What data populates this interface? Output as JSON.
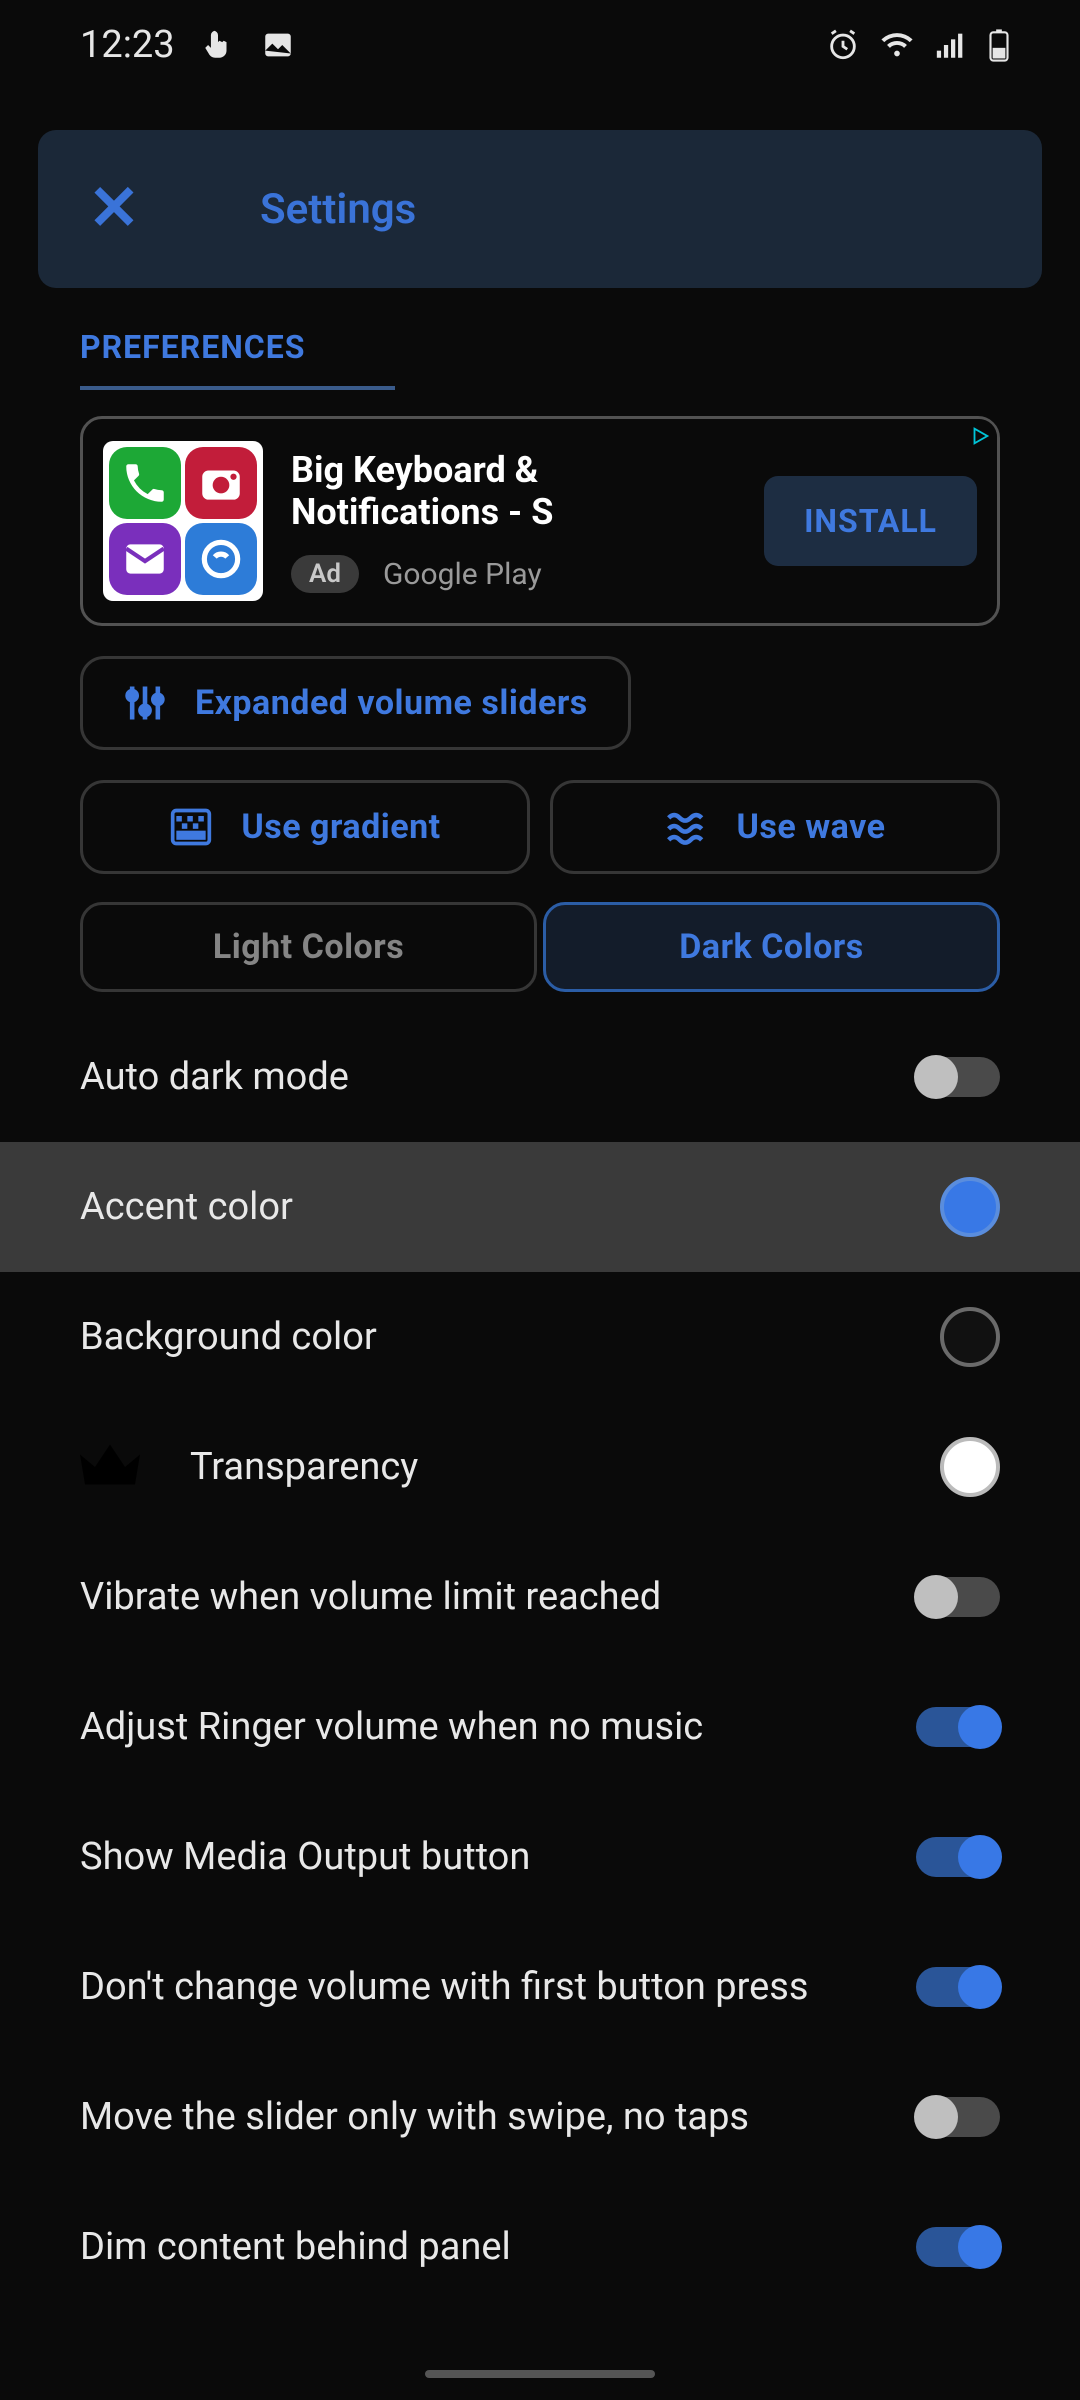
{
  "status": {
    "time": "12:23"
  },
  "header": {
    "title": "Settings"
  },
  "tabs": {
    "preferences": "PREFERENCES"
  },
  "ad": {
    "title": "Big Keyboard & Notifications - S",
    "badge": "Ad",
    "source": "Google Play",
    "cta": "INSTALL"
  },
  "buttons": {
    "expanded_sliders": "Expanded volume sliders",
    "use_gradient": "Use gradient",
    "use_wave": "Use wave"
  },
  "segments": {
    "light": "Light Colors",
    "dark": "Dark Colors"
  },
  "prefs": {
    "auto_dark": "Auto dark mode",
    "accent": "Accent color",
    "background": "Background color",
    "transparency": "Transparency",
    "vibrate_limit": "Vibrate when volume limit reached",
    "adjust_ringer": "Adjust Ringer volume when no music",
    "show_media": "Show Media Output button",
    "no_change_first": "Don't change volume with first button press",
    "swipe_only": "Move the slider only with swipe, no taps",
    "dim_content": "Dim content behind panel"
  },
  "colors": {
    "accent": "#3878e6",
    "background": "#111111",
    "transparency": "#ffffff"
  }
}
